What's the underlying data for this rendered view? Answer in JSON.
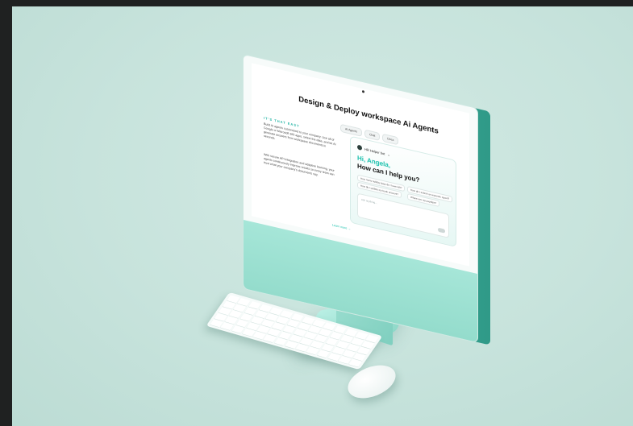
{
  "screen": {
    "headline": "Design & Deploy workspace Ai Agents",
    "tabs": [
      "AI Agents",
      "Chat",
      "Docs"
    ],
    "tagline": "IT'S THAT EASY",
    "para1": "Build AI agents customized to your company. Use all of Google or Microsoft 365 apps, select the data, and let AI generate answers from workspace documents in seconds.",
    "para2": "With secure API integration and adaptive learning, your agents continuously improve results so every team can trust what your company's documents say.",
    "chat": {
      "agent_label": "HR Helper bot",
      "greeting": "Hi, Angela,",
      "prompt": "How can I help you?",
      "suggestions": [
        "How many holiday days do I have left?",
        "How do I submit an expense report?",
        "How do I update my bank account?",
        "Where are my payslips?"
      ],
      "input_placeholder": "Ask anything..."
    },
    "footer_link": "Learn more →"
  },
  "colors": {
    "accent": "#1bc1ad",
    "monitor_chin": "#a6e6d8",
    "background": "#c7e3dc"
  }
}
